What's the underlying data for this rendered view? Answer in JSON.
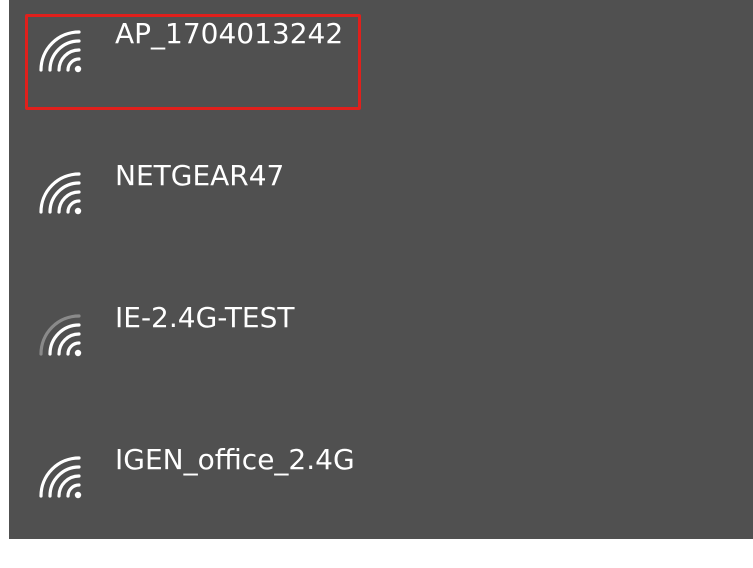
{
  "networks": [
    {
      "name": "AP_1704013242",
      "signal_icon": "wifi-signal-icon",
      "selected": true
    },
    {
      "name": "NETGEAR47",
      "signal_icon": "wifi-signal-icon",
      "selected": false
    },
    {
      "name": "IE-2.4G-TEST",
      "signal_icon": "wifi-signal-icon",
      "selected": false
    },
    {
      "name": "IGEN_office_2.4G",
      "signal_icon": "wifi-signal-icon",
      "selected": false
    }
  ],
  "colors": {
    "panel_background": "#505050",
    "text": "#ffffff",
    "highlight_border": "#e0201c"
  }
}
